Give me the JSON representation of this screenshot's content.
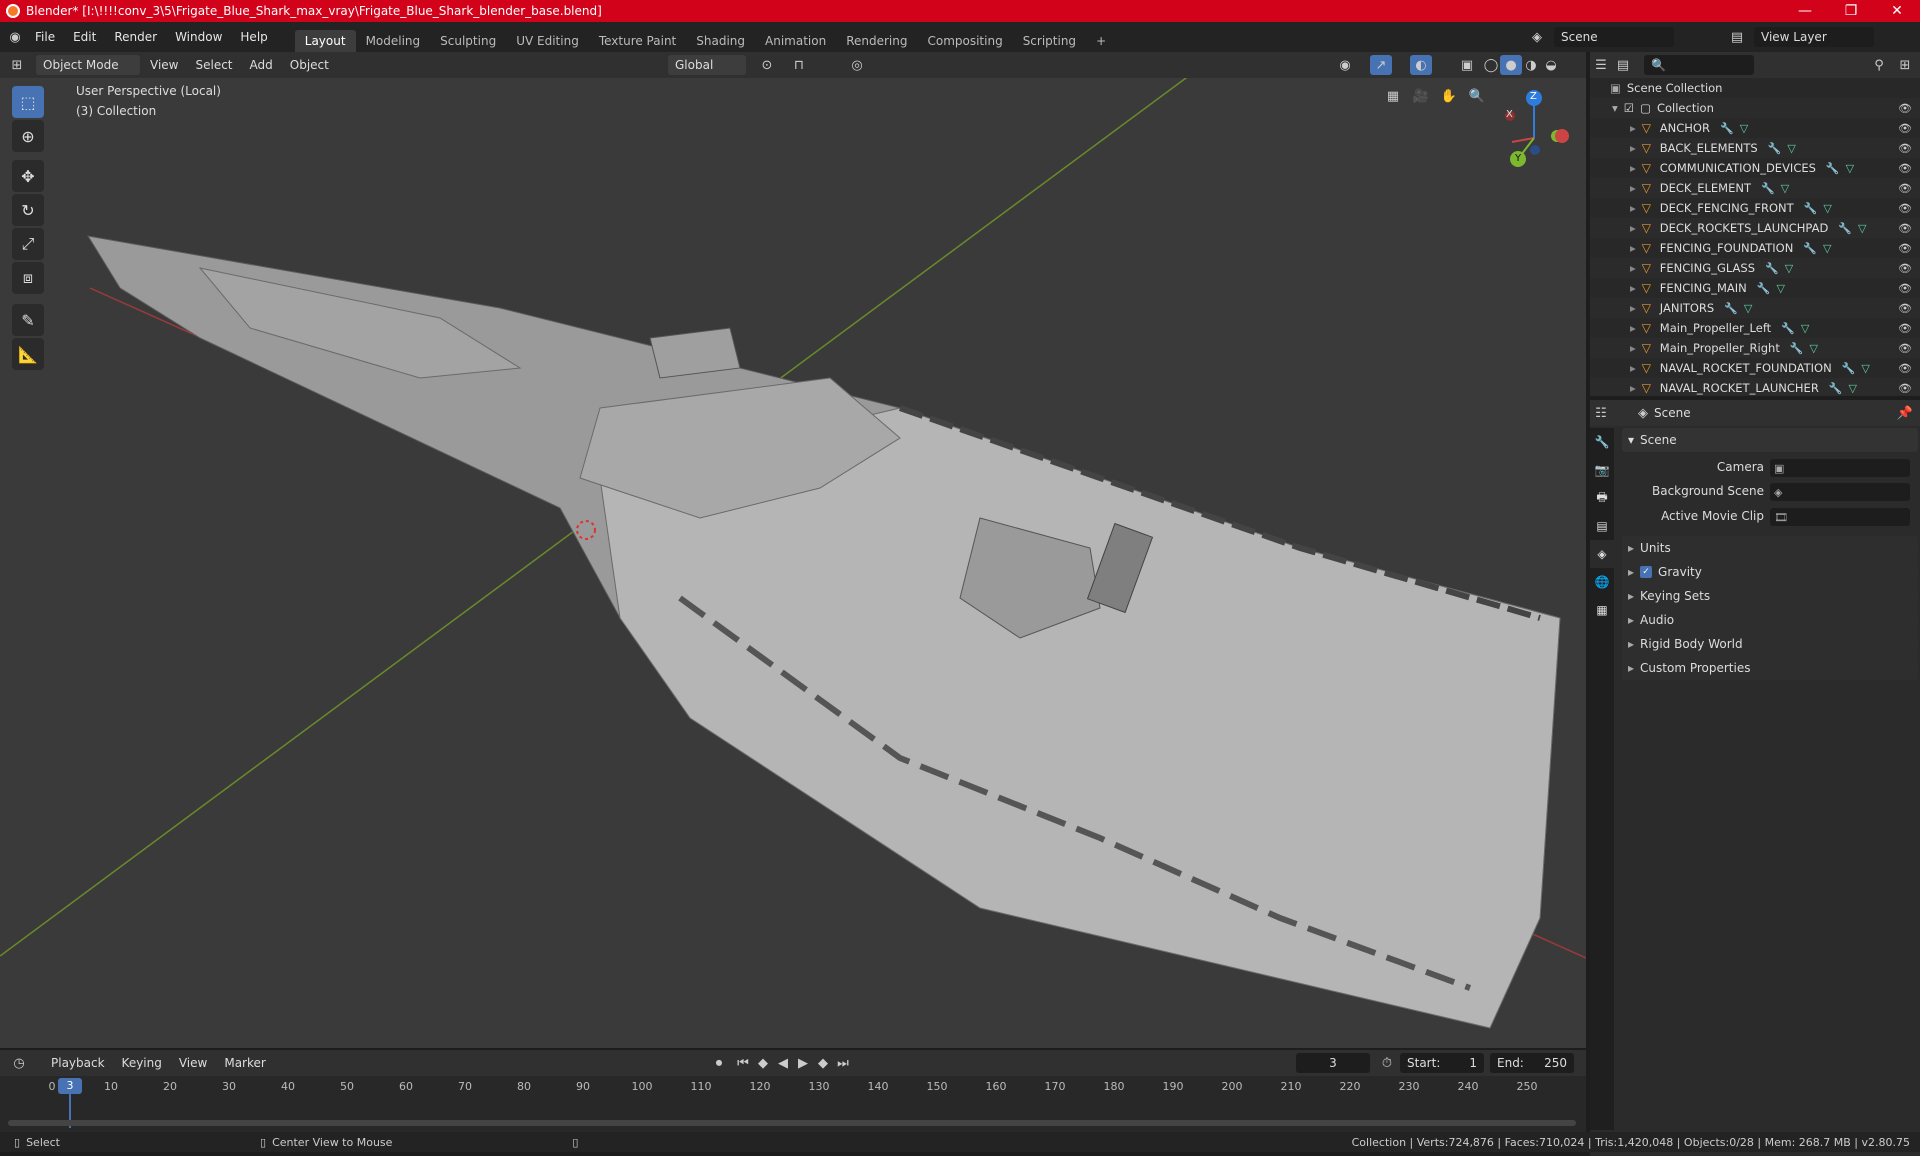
{
  "titlebar": {
    "title": "Blender* [I:\\!!!!conv_3\\5\\Frigate_Blue_Shark_max_vray\\Frigate_Blue_Shark_blender_base.blend]",
    "min": "—",
    "max": "❐",
    "close": "✕"
  },
  "menu": [
    "File",
    "Edit",
    "Render",
    "Window",
    "Help"
  ],
  "workspaces": [
    "Layout",
    "Modeling",
    "Sculpting",
    "UV Editing",
    "Texture Paint",
    "Shading",
    "Animation",
    "Rendering",
    "Compositing",
    "Scripting",
    "+"
  ],
  "scene": {
    "name": "Scene",
    "view_layer": "View Layer"
  },
  "viewport_header": {
    "mode": "Object Mode",
    "view": "View",
    "select": "Select",
    "add": "Add",
    "object": "Object",
    "transform": "Global"
  },
  "viewport": {
    "perspective": "User Perspective (Local)",
    "collection": "(3) Collection",
    "axes": {
      "x": "X",
      "y": "Y",
      "z": "Z"
    }
  },
  "outliner": {
    "root": "Scene Collection",
    "collection": "Collection",
    "items": [
      "ANCHOR",
      "BACK_ELEMENTS",
      "COMMUNICATION_DEVICES",
      "DECK_ELEMENT",
      "DECK_FENCING_FRONT",
      "DECK_ROCKETS_LAUNCHPAD",
      "FENCING_FOUNDATION",
      "FENCING_GLASS",
      "FENCING_MAIN",
      "JANITORS",
      "Main_Propeller_Left",
      "Main_Propeller_Right",
      "NAVAL_ROCKET_FOUNDATION",
      "NAVAL_ROCKET_LAUNCHER"
    ]
  },
  "properties": {
    "context": "Scene",
    "section": "Scene",
    "camera_label": "Camera",
    "background_label": "Background Scene",
    "movie_clip_label": "Active Movie Clip",
    "panels": [
      "Units",
      "Gravity",
      "Keying Sets",
      "Audio",
      "Rigid Body World",
      "Custom Properties"
    ]
  },
  "timeline": {
    "playback": "Playback",
    "keying": "Keying",
    "view": "View",
    "marker": "Marker",
    "current_frame": "3",
    "start_label": "Start:",
    "start": "1",
    "end_label": "End:",
    "end": "250",
    "ticks": [
      "0",
      "10",
      "20",
      "30",
      "40",
      "50",
      "60",
      "70",
      "80",
      "90",
      "100",
      "110",
      "120",
      "130",
      "140",
      "150",
      "160",
      "170",
      "180",
      "190",
      "200",
      "210",
      "220",
      "230",
      "240",
      "250"
    ]
  },
  "status": {
    "select": "Select",
    "center": "Center View to Mouse",
    "stats": "Collection | Verts:724,876 | Faces:710,024 | Tris:1,420,048 | Objects:0/28 | Mem: 268.7 MB | v2.80.75"
  }
}
